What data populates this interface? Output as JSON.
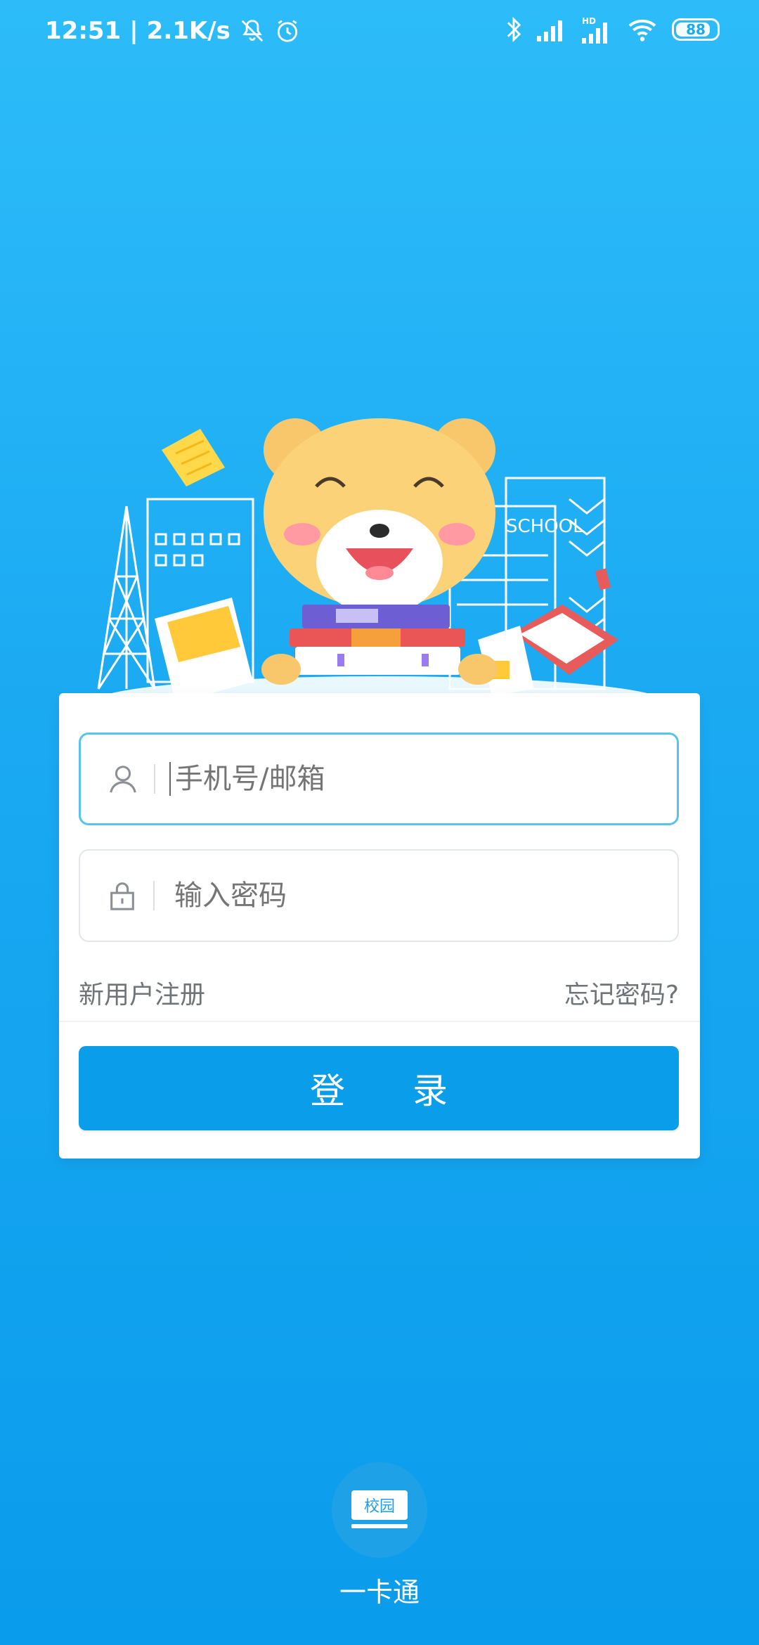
{
  "status_bar": {
    "time": "12:51",
    "network_speed": "2.1K/s",
    "battery": "88",
    "icons": [
      "mute-icon",
      "alarm-icon",
      "bluetooth-icon",
      "signal-icon",
      "hd-signal-icon",
      "wifi-icon",
      "battery-icon"
    ]
  },
  "illustration": {
    "school_label": "SCHOOL"
  },
  "login": {
    "username_placeholder": "手机号/邮箱",
    "password_placeholder": "输入密码",
    "register_label": "新用户注册",
    "forgot_label": "忘记密码?",
    "login_button": "登 录"
  },
  "bottom_app": {
    "badge_text": "校园",
    "label": "一卡通"
  },
  "colors": {
    "background_top": "#2dbcf9",
    "background_bottom": "#0a9cec",
    "primary_button": "#0a9de9",
    "focused_border": "#58c4ea"
  }
}
